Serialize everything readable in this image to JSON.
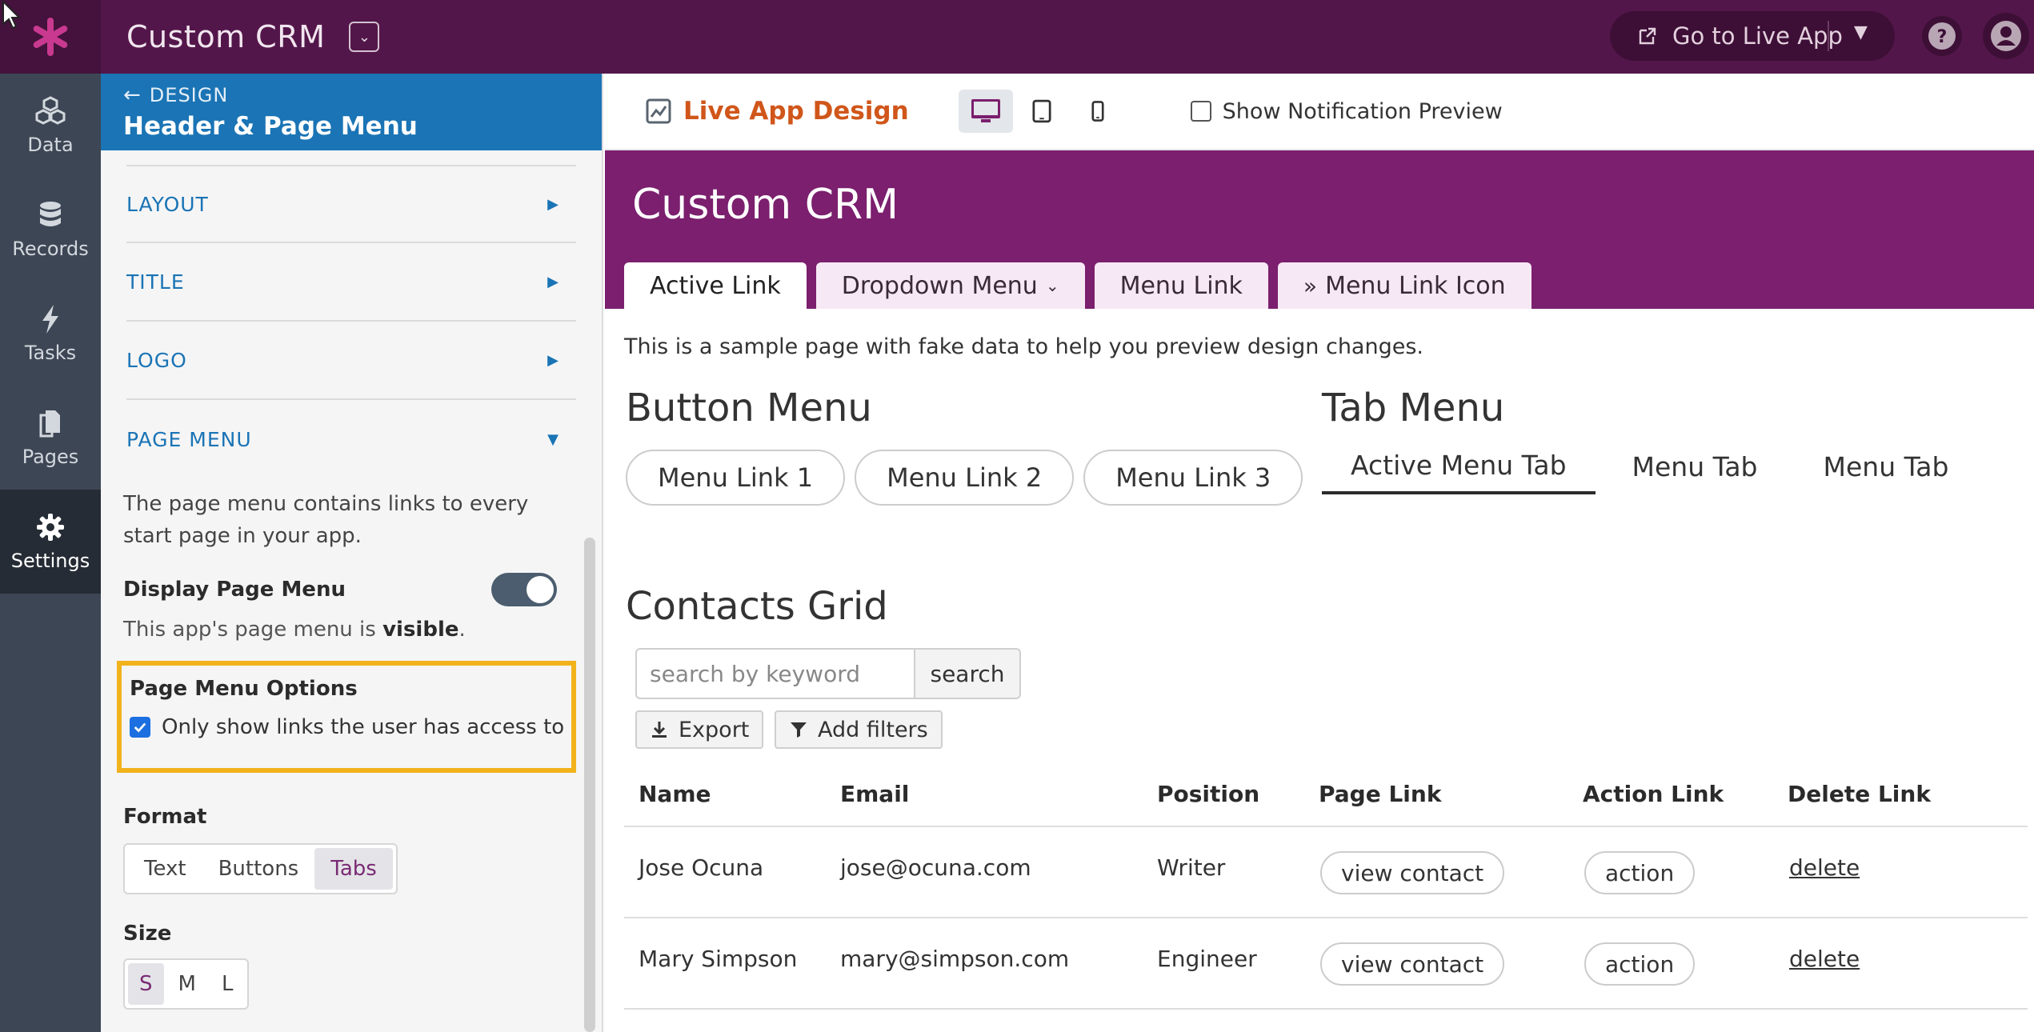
{
  "topbar": {
    "app_title": "Custom CRM",
    "go_live_label": "Go to Live App",
    "icons": [
      "asterisk-logo-icon",
      "chevron-down-icon",
      "external-link-icon",
      "caret-down-icon",
      "help-icon",
      "user-icon"
    ]
  },
  "leftnav": {
    "items": [
      {
        "label": "Data",
        "icon": "cubes-icon"
      },
      {
        "label": "Records",
        "icon": "database-icon"
      },
      {
        "label": "Tasks",
        "icon": "bolt-icon"
      },
      {
        "label": "Pages",
        "icon": "pages-icon"
      },
      {
        "label": "Settings",
        "icon": "gear-icon",
        "active": true
      }
    ]
  },
  "panel": {
    "breadcrumb": "DESIGN",
    "title": "Header & Page Menu",
    "accordions": [
      "LAYOUT",
      "TITLE",
      "LOGO",
      "PAGE MENU"
    ],
    "page_menu": {
      "description": "The page menu contains links to every start page in your app.",
      "display_label": "Display Page Menu",
      "display_on": true,
      "status_prefix": "This app's page menu is ",
      "status_value": "visible",
      "status_suffix": ".",
      "options_title": "Page Menu Options",
      "option_label": "Only show links the user has access to",
      "option_checked": true,
      "format_label": "Format",
      "format_options": [
        "Text",
        "Buttons",
        "Tabs"
      ],
      "format_selected": "Tabs",
      "size_label": "Size",
      "size_options": [
        "S",
        "M",
        "L"
      ],
      "size_selected": "S"
    }
  },
  "preview_toolbar": {
    "title": "Live App Design",
    "devices": [
      "desktop-icon",
      "tablet-icon",
      "mobile-icon"
    ],
    "device_selected": "desktop-icon",
    "notification_label": "Show Notification Preview",
    "notification_checked": false
  },
  "preview": {
    "app_title": "Custom CRM",
    "tabs": [
      {
        "label": "Active Link",
        "active": true
      },
      {
        "label": "Dropdown Menu",
        "dropdown": true
      },
      {
        "label": "Menu Link"
      },
      {
        "label": "Menu Link Icon",
        "icon": "double-chevron-right-icon"
      }
    ],
    "sample_note": "This is a sample page with fake data to help you preview design changes.",
    "button_menu": {
      "title": "Button Menu",
      "links": [
        "Menu Link 1",
        "Menu Link 2",
        "Menu Link 3"
      ]
    },
    "tab_menu": {
      "title": "Tab Menu",
      "tabs": [
        "Active Menu Tab",
        "Menu Tab",
        "Menu Tab"
      ]
    },
    "grid": {
      "title": "Contacts Grid",
      "search_placeholder": "search by keyword",
      "search_button": "search",
      "export_label": "Export",
      "filters_label": "Add filters",
      "columns": [
        "Name",
        "Email",
        "Position",
        "Page Link",
        "Action Link",
        "Delete Link"
      ],
      "rows": [
        {
          "name": "Jose Ocuna",
          "email": "jose@ocuna.com",
          "position": "Writer",
          "page_link": "view contact",
          "action_link": "action",
          "delete_link": "delete"
        },
        {
          "name": "Mary Simpson",
          "email": "mary@simpson.com",
          "position": "Engineer",
          "page_link": "view contact",
          "action_link": "action",
          "delete_link": "delete"
        }
      ]
    }
  },
  "colors": {
    "topbar": "#53164a",
    "nav": "#3d4654",
    "panel_header": "#1a74b5",
    "preview_header": "#7b1f6e",
    "accent_orange": "#d0561a",
    "highlight": "#f1b21c"
  }
}
